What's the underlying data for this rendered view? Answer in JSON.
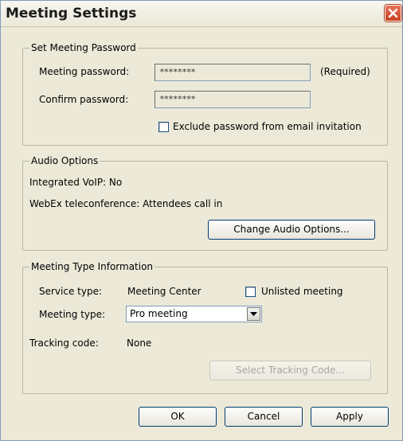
{
  "window": {
    "title": "Meeting Settings",
    "close_icon": "close-icon"
  },
  "password_group": {
    "legend": "Set Meeting Password",
    "meeting_password_label": "Meeting password:",
    "meeting_password_value": "********",
    "required_label": "(Required)",
    "confirm_password_label": "Confirm password:",
    "confirm_password_value": "********",
    "exclude_checkbox_label": "Exclude password from email invitation",
    "exclude_checked": false
  },
  "audio_group": {
    "legend": "Audio Options",
    "integrated_voip": "Integrated VoIP: No",
    "webex_teleconference": "WebEx teleconference: Attendees call in",
    "change_audio_button": "Change Audio Options..."
  },
  "meeting_type_group": {
    "legend": "Meeting Type Information",
    "service_type_label": "Service type:",
    "service_type_value": "Meeting Center",
    "unlisted_label": "Unlisted meeting",
    "unlisted_checked": false,
    "meeting_type_label": "Meeting type:",
    "meeting_type_selected": "Pro meeting",
    "tracking_code_label": "Tracking code:",
    "tracking_code_value": "None",
    "select_tracking_button": "Select Tracking Code..."
  },
  "footer": {
    "ok_button": "OK",
    "cancel_button": "Cancel",
    "apply_button": "Apply"
  },
  "colors": {
    "dialog_bg": "#ece9d8",
    "close_button": "#d4502b",
    "button_border": "#003c74",
    "disabled_text": "#a7a6a0"
  }
}
